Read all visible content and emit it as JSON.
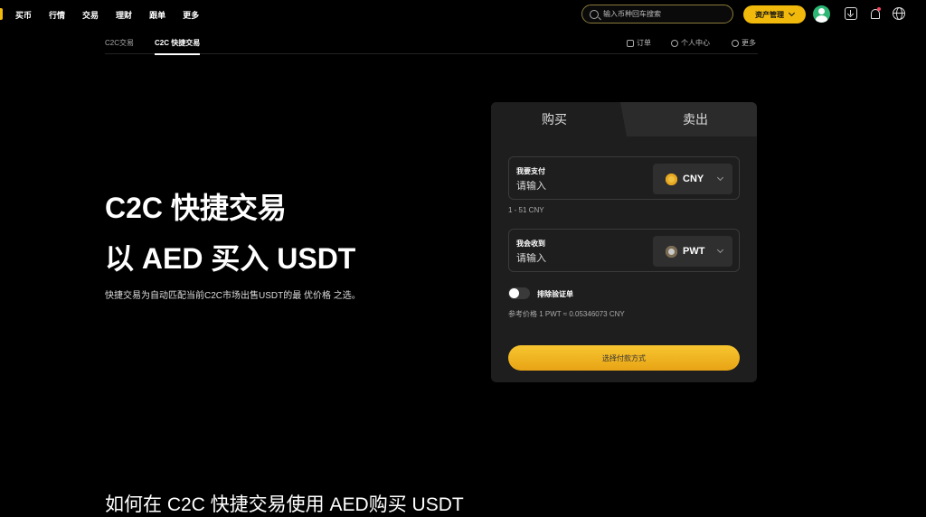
{
  "topnav": {
    "items": [
      "买币",
      "行情",
      "交易",
      "理财",
      "跟单",
      "更多"
    ],
    "search_placeholder": "输入币种回车搜索",
    "asset_button": "资产管理"
  },
  "subnav": {
    "tabs": [
      "C2C交易",
      "C2C 快捷交易"
    ],
    "links": [
      "订单",
      "个人中心",
      "更多"
    ]
  },
  "hero": {
    "title": "C2C 快捷交易",
    "subtitle": "以 AED 买入 USDT",
    "description": "快捷交易为自动匹配当前C2C市场出售USDT的最 优价格 之选。",
    "how_title": "如何在 C2C 快捷交易使用 AED购买 USDT"
  },
  "card": {
    "tab_buy": "购买",
    "tab_sell": "卖出",
    "pay": {
      "label": "我要支付",
      "placeholder": "请输入",
      "currency": "CNY"
    },
    "range": "1 - 51 CNY",
    "receive": {
      "label": "我会收到",
      "placeholder": "请输入",
      "currency": "PWT"
    },
    "toggle_label": "排除验证单",
    "ref_price": "参考价格 1 PWT ≈ 0.05346073 CNY",
    "pay_button": "选择付款方式"
  },
  "colors": {
    "accent": "#f0b90b",
    "background": "#000000",
    "card": "#1e1e1e"
  }
}
